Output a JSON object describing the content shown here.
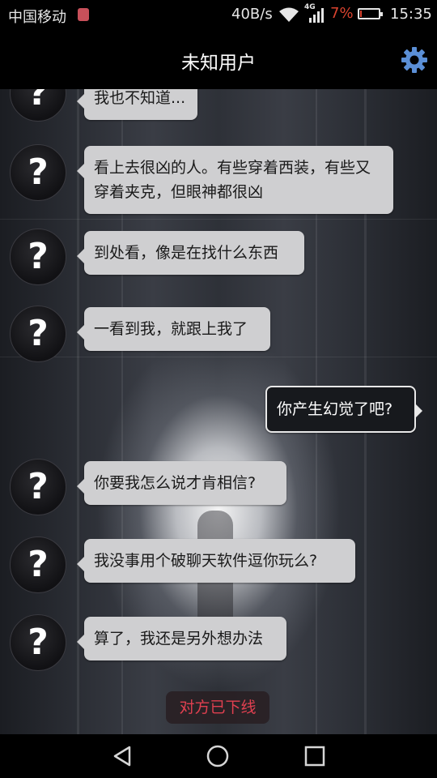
{
  "status_bar": {
    "carrier": "中国移动",
    "net_speed": "40B/s",
    "network_type": "4G",
    "battery_percent": "7%",
    "battery_level": 0.07,
    "time": "15:35",
    "colors": {
      "battery_low": "#d9432f"
    }
  },
  "header": {
    "title": "未知用户",
    "settings_icon": "gear-icon",
    "colors": {
      "gear": "#5b8fd6"
    }
  },
  "messages": [
    {
      "side": "left",
      "avatar": "?",
      "text": "我也不知道..."
    },
    {
      "side": "left",
      "avatar": "?",
      "text": "看上去很凶的人。有些穿着西装，有些又穿着夹克，但眼神都很凶"
    },
    {
      "side": "left",
      "avatar": "?",
      "text": "到处看，像是在找什么东西"
    },
    {
      "side": "left",
      "avatar": "?",
      "text": "一看到我，就跟上我了"
    },
    {
      "side": "right",
      "text": "你产生幻觉了吧?"
    },
    {
      "side": "left",
      "avatar": "?",
      "text": "你要我怎么说才肯相信?"
    },
    {
      "side": "left",
      "avatar": "?",
      "text": "我没事用个破聊天软件逗你玩么?"
    },
    {
      "side": "left",
      "avatar": "?",
      "text": "算了，我还是另外想办法"
    }
  ],
  "offline_notice": "对方已下线",
  "nav_bar": {
    "back_icon": "back-triangle-icon",
    "home_icon": "home-circle-icon",
    "recents_icon": "recents-square-icon"
  }
}
